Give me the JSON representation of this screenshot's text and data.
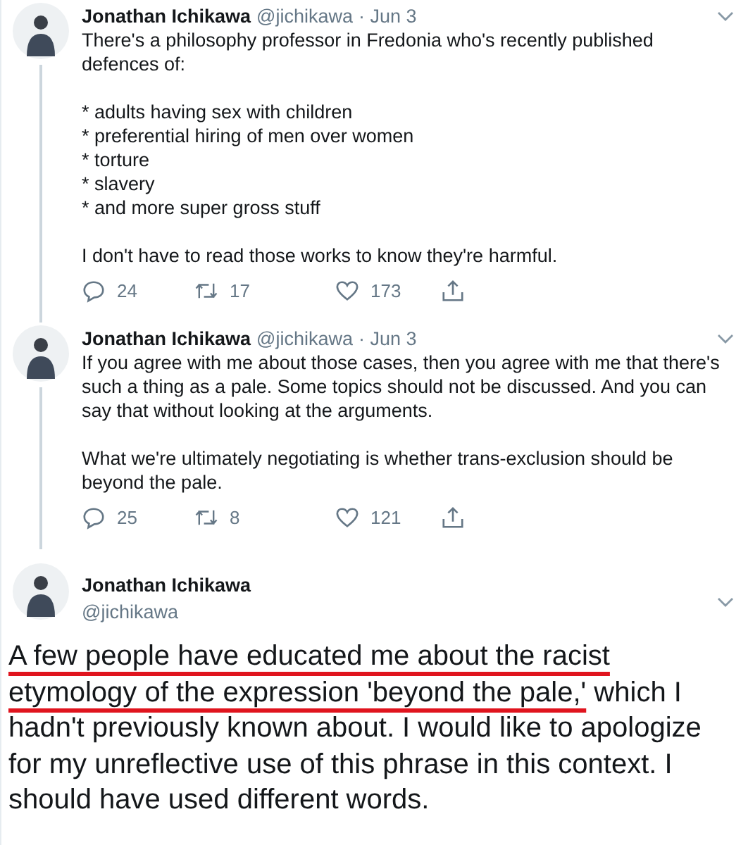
{
  "tweets": [
    {
      "kind": "thread",
      "name": "Jonathan Ichikawa",
      "handle": "@jichikawa",
      "date": "· Jun 3",
      "text": "There's a philosophy professor in Fredonia who's recently published defences of:\n\n* adults having sex with children\n* preferential hiring of men over women\n* torture\n* slavery\n* and more super gross stuff\n\nI don't have to read those works to know they're harmful.",
      "replies": "24",
      "retweets": "17",
      "likes": "173"
    },
    {
      "kind": "thread",
      "name": "Jonathan Ichikawa",
      "handle": "@jichikawa",
      "date": "· Jun 3",
      "text": "If you agree with me about those cases, then you agree with me that there's such a thing as a pale. Some topics should not be discussed. And you can say that without looking at the arguments.\n\nWhat we're ultimately negotiating is whether trans-exclusion should be beyond the pale.",
      "replies": "25",
      "retweets": "8",
      "likes": "121"
    },
    {
      "kind": "focused",
      "name": "Jonathan Ichikawa",
      "handle": "@jichikawa",
      "segments": [
        {
          "text": "A few people have educated me about the racist etymology of the expression 'beyond the pale,'",
          "underlined": true
        },
        {
          "text": " which I hadn't previously known about. I would like to apologize for my unreflective use of this phrase in this context. I should have used different words.",
          "underlined": false
        }
      ]
    }
  ]
}
